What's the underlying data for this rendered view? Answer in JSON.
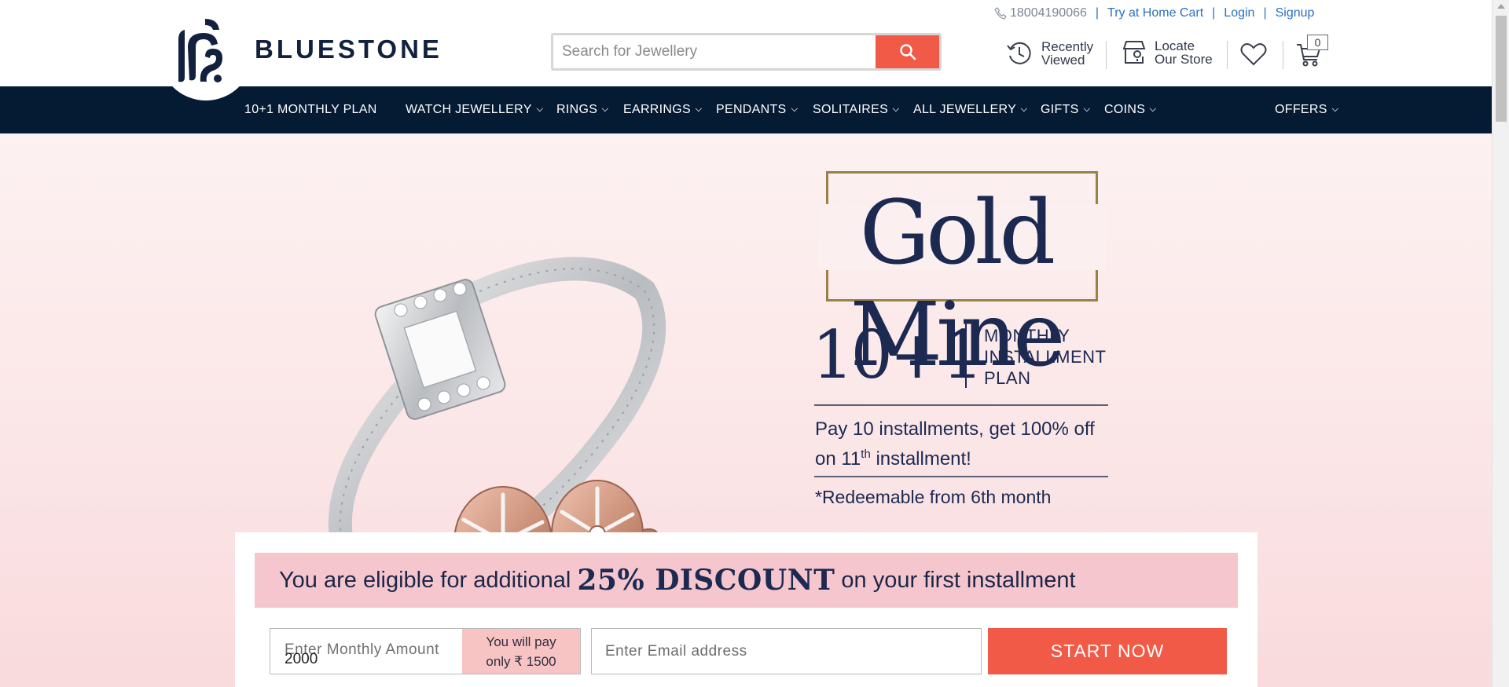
{
  "brand": {
    "name": "BLUESTONE"
  },
  "top_links": {
    "phone": "18004190066",
    "try_home": "Try at Home Cart",
    "login": "Login",
    "signup": "Signup",
    "separator": "|"
  },
  "search": {
    "placeholder": "Search for Jewellery",
    "value": ""
  },
  "utilities": {
    "recently_line1": "Recently",
    "recently_line2": "Viewed",
    "locate_line1": "Locate",
    "locate_line2": "Our Store",
    "cart_count": "0"
  },
  "nav": {
    "items": [
      {
        "label": "10+1 MONTHLY PLAN"
      },
      {
        "label": "WATCH JEWELLERY"
      },
      {
        "label": "RINGS"
      },
      {
        "label": "EARRINGS"
      },
      {
        "label": "PENDANTS"
      },
      {
        "label": "SOLITAIRES"
      },
      {
        "label": "ALL JEWELLERY"
      },
      {
        "label": "GIFTS"
      },
      {
        "label": "COINS"
      },
      {
        "label": "OFFERS"
      }
    ]
  },
  "hero": {
    "title": "Gold Mine",
    "plan_number": "10+1",
    "plan_line1": "MONTHLY",
    "plan_line2": "INSTALLMENT",
    "plan_line3": "PLAN",
    "pay_line1": "Pay 10 installments, get 100% off",
    "pay_line2_pre": "on 11",
    "pay_line2_sup": "th",
    "pay_line2_post": " installment!",
    "redeem": "*Redeemable from 6th month"
  },
  "form": {
    "discount_pre": "You are eligible for additional",
    "discount_highlight": "25% DISCOUNT",
    "discount_post": "on your first installment",
    "amount_placeholder": "Enter Monthly Amount",
    "amount_value": "2000",
    "pay_line1": "You will pay",
    "pay_line2": "only ₹ 1500",
    "email_placeholder": "Enter Email address",
    "start_label": "START NOW"
  },
  "colors": {
    "navy": "#051a33",
    "accent": "#f05a46",
    "link": "#2b71c0",
    "banner_pink": "#f5c6ce",
    "gold_frame": "#9a8244"
  }
}
